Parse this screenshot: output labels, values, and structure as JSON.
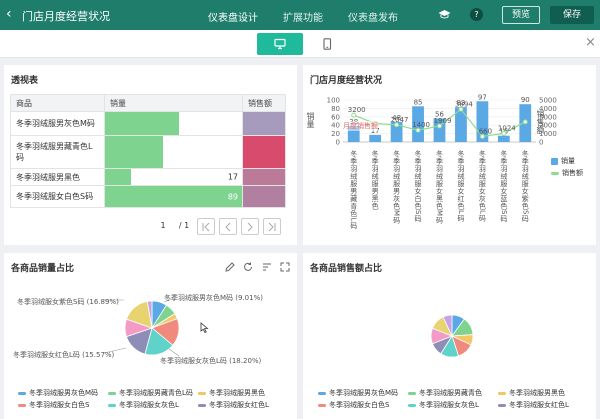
{
  "header": {
    "back_glyph": "‹",
    "title": "门店月度经营状况",
    "nav": [
      "仪表盘设计",
      "扩展功能",
      "仪表盘发布"
    ],
    "help_glyph": "?",
    "preview_label": "预览",
    "save_label": "保存",
    "accent": "#1f7d6b"
  },
  "toolbar": {
    "devices": [
      "desktop-icon",
      "mobile-icon"
    ],
    "active_device": "desktop",
    "close_glyph": "×"
  },
  "pivot": {
    "title": "透视表",
    "headers": [
      "商品",
      "销量",
      "销售额"
    ],
    "rows": [
      {
        "name": "冬季羽绒服男灰色M码",
        "qty": 48,
        "qty_fill": 0.539,
        "qty_color": "#7ed48f",
        "amount_color": "#a79bbd"
      },
      {
        "name": "冬季羽绒服男藏青色L码",
        "qty": 38,
        "qty_fill": 0.427,
        "qty_color": "#7ed48f",
        "amount_color": "#d94b6c"
      },
      {
        "name": "冬季羽绒服男黑色",
        "qty": 17,
        "qty_fill": 0.191,
        "qty_color": "#7ed48f",
        "amount_color": "#bb7a98"
      },
      {
        "name": "冬季羽绒服女白色S码",
        "qty": 89,
        "qty_fill": 1.0,
        "qty_color": "#7ed48f",
        "amount_color": "#b17fa0"
      }
    ],
    "page_current": "1",
    "page_total": "/ 1"
  },
  "combo": {
    "title": "门店月度经营状况",
    "y1_label": "销量",
    "y2_label": "销售额",
    "legend": [
      "销量",
      "销售额"
    ],
    "tooltip_label": "月度销售额"
  },
  "qty_pie": {
    "title": "各商品销量占比",
    "labels": [
      "冬季羽绒服女紫色S码 (16.89%)",
      "冬季羽绒服男灰色M码 (9.01%)",
      "冬季羽绒服女红色L码 (15.57%)",
      "冬季羽绒服女灰色L码 (18.20%)"
    ],
    "legend": [
      "冬季羽绒服男灰色M码",
      "冬季羽绒服男藏青色L码",
      "冬季羽绒服男黑色",
      "冬季羽绒服女白色S",
      "冬季羽绒服女灰色L",
      "冬季羽绒服女红色L"
    ]
  },
  "amount_pie": {
    "title": "各商品销售额占比",
    "legend": [
      "冬季羽绒服男灰色M码",
      "冬季羽绒服男藏青色",
      "冬季羽绒服男黑色",
      "冬季羽绒服女白色S",
      "冬季羽绒服女灰色L",
      "冬季羽绒服女红色L"
    ]
  },
  "chart_data": [
    {
      "type": "bar",
      "title": "门店月度经营状况",
      "categories": [
        "冬季羽绒服男藏青色L码",
        "冬季羽绒服男黑色",
        "冬季羽绒服男灰色M码",
        "冬季羽绒服女白色S码",
        "冬季羽绒服女黑色M码",
        "冬季羽绒服女红色L码",
        "冬季羽绒服女灰色L码",
        "冬季羽绒服女蓝色S码",
        "冬季羽绒服女紫色S码"
      ],
      "series": [
        {
          "name": "销量",
          "type": "bar",
          "axis": "left",
          "values": [
            38,
            17,
            48,
            85,
            56,
            83,
            97,
            15,
            90
          ],
          "labels": [
            "38",
            "17",
            "48",
            "85",
            "56",
            "83",
            "97",
            "15",
            "90"
          ]
        },
        {
          "name": "销售额",
          "type": "line",
          "axis": "right",
          "values": [
            3200,
            2200,
            2047,
            1400,
            1900,
            3894,
            660,
            1024,
            2400
          ],
          "labels": [
            "3200",
            "",
            "2047",
            "1400",
            "1909",
            "3894",
            "660",
            "1024",
            ""
          ]
        }
      ],
      "ylim": [
        0,
        100
      ],
      "y_ticks": [
        0,
        20,
        40,
        60,
        80,
        100
      ],
      "y2lim": [
        0,
        5000
      ],
      "y2_ticks": [
        0,
        1000,
        2000,
        3000,
        4000,
        5000
      ],
      "bar_color": "#5aa8e4",
      "line_color": "#8fdc8f",
      "legend": "right"
    },
    {
      "type": "pie",
      "title": "各商品销量占比",
      "slices": [
        {
          "label": "冬季羽绒服男灰色M码",
          "value": 9.01,
          "color": "#5aa8e4"
        },
        {
          "label": "冬季羽绒服男藏青色L码",
          "value": 7.13,
          "color": "#7ed48f"
        },
        {
          "label": "冬季羽绒服男黑色",
          "value": 3.19,
          "color": "#f5c566"
        },
        {
          "label": "冬季羽绒服女白色S",
          "value": 16.7,
          "color": "#f08a7e"
        },
        {
          "label": "冬季羽绒服女灰色L",
          "value": 18.2,
          "color": "#5fd3c9"
        },
        {
          "label": "冬季羽绒服女红色L",
          "value": 15.57,
          "color": "#8d8db8"
        },
        {
          "label": "冬季羽绒服女黑色M",
          "value": 10.51,
          "color": "#f49ac7"
        },
        {
          "label": "冬季羽绒服女紫色S",
          "value": 16.89,
          "color": "#e7d36f"
        },
        {
          "label": "冬季羽绒服女蓝色S",
          "value": 2.8,
          "color": "#c8a2e8"
        }
      ]
    },
    {
      "type": "pie",
      "title": "各商品销售额占比",
      "slices": [
        {
          "label": "冬季羽绒服男灰色M码",
          "value": 10,
          "color": "#5aa8e4"
        },
        {
          "label": "冬季羽绒服男藏青色",
          "value": 14,
          "color": "#7ed48f"
        },
        {
          "label": "冬季羽绒服男黑色",
          "value": 8,
          "color": "#f5c566"
        },
        {
          "label": "冬季羽绒服女白色S",
          "value": 13,
          "color": "#f08a7e"
        },
        {
          "label": "冬季羽绒服女灰色L",
          "value": 14,
          "color": "#5fd3c9"
        },
        {
          "label": "冬季羽绒服女红色L",
          "value": 10,
          "color": "#8d8db8"
        },
        {
          "label": "冬季羽绒服女黑色M",
          "value": 12,
          "color": "#f49ac7"
        },
        {
          "label": "冬季羽绒服女紫色S",
          "value": 12,
          "color": "#e7d36f"
        },
        {
          "label": "冬季羽绒服女蓝色S",
          "value": 7,
          "color": "#c8a2e8"
        }
      ]
    }
  ]
}
